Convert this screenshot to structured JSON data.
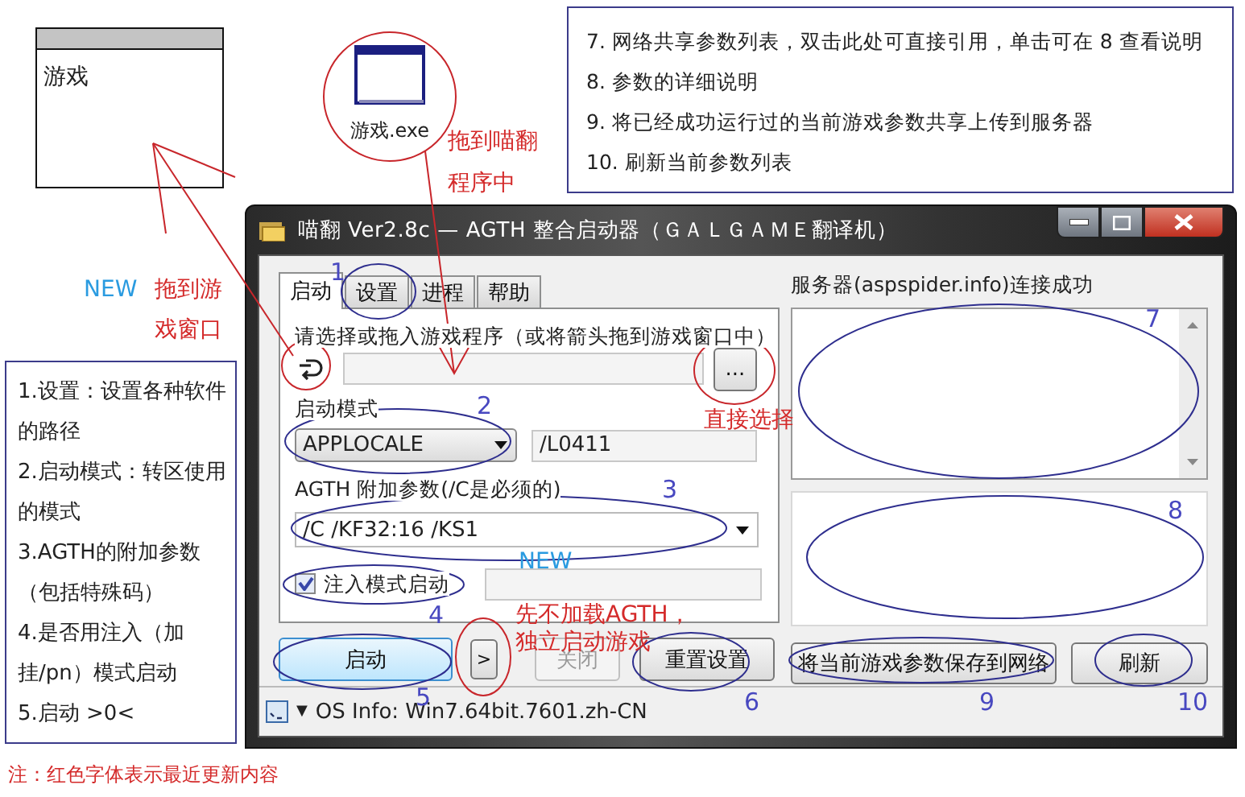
{
  "game_window": {
    "text": "游戏"
  },
  "exe_icon": {
    "label": "游戏.exe"
  },
  "help_top": [
    "7. 网络共享参数列表，双击此处可直接引用，单击可在 8 查看说明",
    "8. 参数的详细说明",
    "9. 将已经成功运行过的当前游戏参数共享上传到服务器",
    "10. 刷新当前参数列表"
  ],
  "help_left": [
    "1.设置：设置各种软件的路径",
    "2.启动模式：转区使用的模式",
    "3.AGTH的附加参数（包括特殊码）",
    "4.是否用注入（加挂/pn）模式启动",
    "5.启动 >0<"
  ],
  "footer_note": "注：红色字体表示最近更新内容",
  "window": {
    "title": "喵翻 Ver2.8c — AGTH 整合启动器（ＧＡＬＧＡＭＥ翻译机）",
    "tabs": [
      {
        "label": "启动",
        "selected": true
      },
      {
        "label": "设置",
        "selected": false
      },
      {
        "label": "进程",
        "selected": false
      },
      {
        "label": "帮助",
        "selected": false
      }
    ],
    "program_label": "请选择或拖入游戏程序（或将箭头拖到游戏窗口中）",
    "browse_button": "...",
    "mode_label": "启动模式",
    "mode_select": "APPLOCALE",
    "mode_param": "/L0411",
    "agth_label": "AGTH 附加参数(/C是必须的)",
    "agth_select": "/C /KF32:16 /KS1",
    "inject_mode": {
      "label": "注入模式启动",
      "checked": true
    },
    "buttons": [
      {
        "kind": "primary",
        "label": "启动",
        "disabled": false
      },
      {
        "kind": "small",
        "label": ">",
        "disabled": false
      },
      {
        "kind": "normal",
        "label": "关闭",
        "disabled": true
      },
      {
        "kind": "normal",
        "label": "重置设置",
        "disabled": false
      }
    ],
    "server_status": "服务器(aspspider.info)连接成功",
    "server_buttons": [
      "将当前游戏参数保存到网络",
      "刷新"
    ],
    "status_bar": {
      "dropdown": "▼",
      "text": "OS Info: Win7.64bit.7601.zh-CN"
    }
  },
  "callouts": [
    {
      "kind": "number",
      "text": "1"
    },
    {
      "kind": "number",
      "text": "2"
    },
    {
      "kind": "number",
      "text": "3"
    },
    {
      "kind": "number",
      "text": "4"
    },
    {
      "kind": "number",
      "text": "5"
    },
    {
      "kind": "number",
      "text": "6"
    },
    {
      "kind": "number",
      "text": "7"
    },
    {
      "kind": "number",
      "text": "8"
    },
    {
      "kind": "number",
      "text": "9"
    },
    {
      "kind": "number",
      "text": "10"
    },
    {
      "kind": "red",
      "text": "拖到喵翻"
    },
    {
      "kind": "red",
      "text": "程序中"
    },
    {
      "kind": "new",
      "text": "NEW"
    },
    {
      "kind": "red",
      "text": "拖到游"
    },
    {
      "kind": "red",
      "text": "戏窗口"
    },
    {
      "kind": "red",
      "text": "直接选择"
    },
    {
      "kind": "new",
      "text": "NEW"
    },
    {
      "kind": "red",
      "text": "先不加载AGTH，"
    },
    {
      "kind": "red",
      "text": "独立启动游戏"
    }
  ]
}
